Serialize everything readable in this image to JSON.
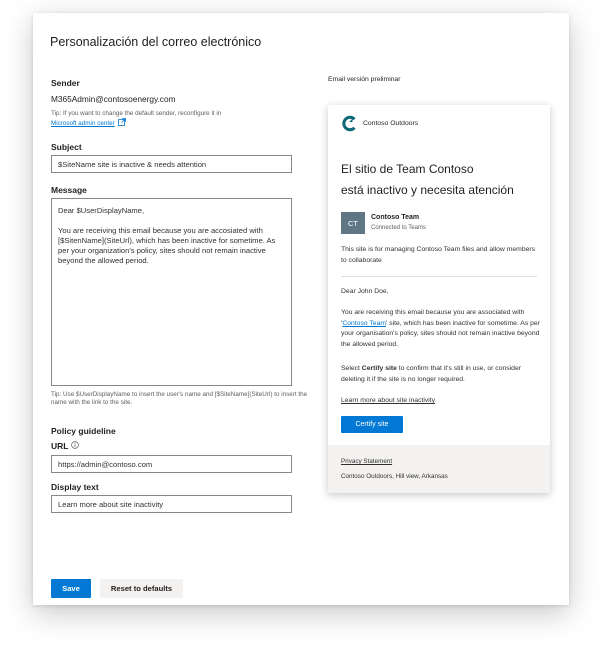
{
  "page": {
    "title": "Personalización del correo electrónico"
  },
  "sender": {
    "label": "Sender",
    "value": "M365Admin@contosoenergy.com",
    "tip": "Tip: If you want to change the default sender, reconfigure it in",
    "tip_link": "Microsoft admin center"
  },
  "subject": {
    "label": "Subject",
    "value": "$SiteName site is inactive & needs attention"
  },
  "message": {
    "label": "Message",
    "value": "Dear $UserDisplayName,\n\nYou are receiving this email because you are accosiated with [$SitenName](SiteUrl), which has been inactive for sometime. As per your organization's policy, sites should not remain inactive beyond the allowed period.",
    "tip": "Tip: Use $UserDisplayName to insert the user's name and [$SiteName](SiteUrl) to insert the name with the link to the site."
  },
  "policy": {
    "heading": "Policy guideline",
    "url_label": "URL",
    "url_value": "https://admin@contoso.com",
    "display_label": "Display text",
    "display_value": "Learn more about site inactivity"
  },
  "buttons": {
    "save": "Save",
    "reset": "Reset to defaults"
  },
  "preview": {
    "label": "Email versión preliminar",
    "brand": "Contoso Outdoors",
    "headline_line1": "El sitio de Team Contoso",
    "headline_line2": "está inactivo y necesita atención",
    "team_initials": "CT",
    "team_name": "Contoso Team",
    "team_sub": "Connected to Teams",
    "site_desc": "This site is for managing Contoso Team files and allow members to collaborate",
    "greeting": "Dear John Doe,",
    "body_pre": "You are receiving this email because you are associated with '",
    "body_link": "Contoso Team",
    "body_post": "' site, which has been inactive for sometime. As per your organisation's policy, sites should not remain inactive beyond the allowed period.",
    "select_pre": "Select ",
    "select_bold": "Certify site",
    "select_post": " to confirm that it's still in use, or consider deleting it if the site is no longer required.",
    "learn_link": "Learn more about site inactivity",
    "certify_button": "Certify site",
    "privacy": "Privacy Statement",
    "address": "Contoso Outdoors, Hill view, Arkansas"
  },
  "colors": {
    "accent": "#0078d4",
    "brand_teal": "#0b6a75",
    "avatar_bg": "#5f7784",
    "footer_bg": "#f3f2f1"
  },
  "icons": {
    "external_link": "external-link-icon",
    "info": "info-icon",
    "brand_logo": "contoso-logo-icon"
  }
}
